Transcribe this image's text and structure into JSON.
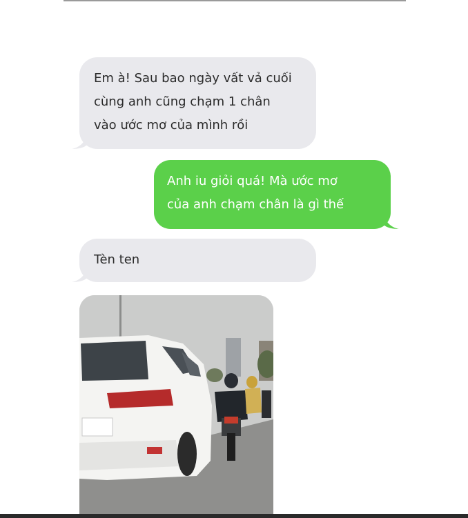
{
  "conversation": {
    "messages": [
      {
        "sender": "received",
        "lines": [
          "Em à! Sau bao ngày vất vả cuối",
          "cùng anh cũng chạm 1 chân",
          "vào ước mơ của mình rồi"
        ]
      },
      {
        "sender": "sent",
        "lines": [
          "Anh iu giỏi quá! Mà ước mơ",
          "của anh chạm chân là gì thế"
        ]
      },
      {
        "sender": "received",
        "lines": [
          "Tèn ten"
        ]
      }
    ],
    "photo": {
      "sender": "received",
      "content": "white SUV next to a motorbike rider on a city street"
    }
  },
  "colors": {
    "received_bubble": "#e9e9ed",
    "sent_bubble": "#5bd04a",
    "received_text": "#2b2b2b",
    "sent_text": "#ffffff"
  }
}
